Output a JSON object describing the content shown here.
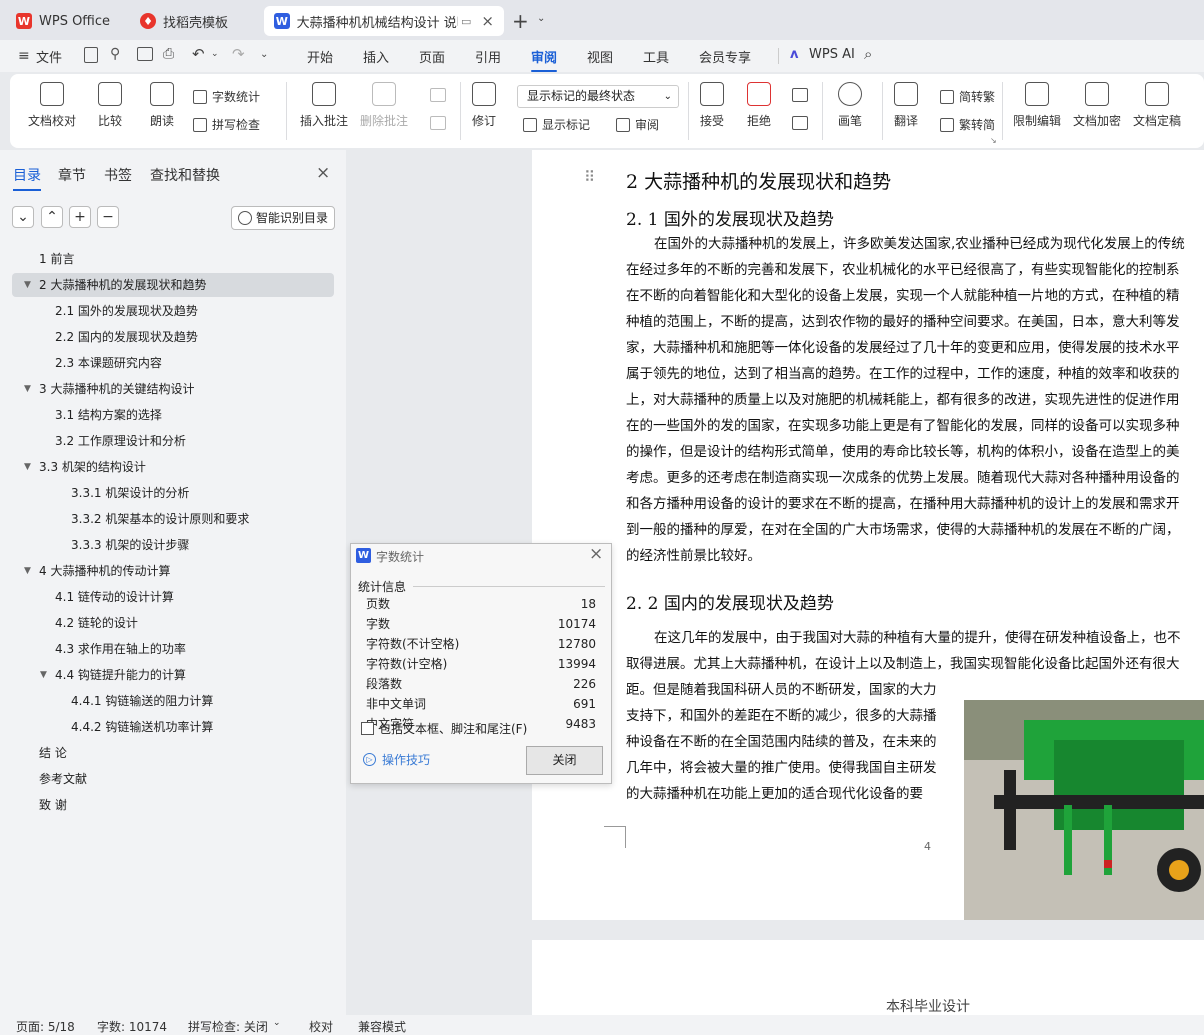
{
  "tabs": [
    {
      "label": "WPS Office"
    },
    {
      "label": "找稻壳模板"
    },
    {
      "label": "大蒜播种机机械结构设计 说明"
    }
  ],
  "menu": {
    "file": "文件",
    "items": [
      "开始",
      "插入",
      "页面",
      "引用",
      "审阅",
      "视图",
      "工具",
      "会员专享"
    ],
    "ai": "WPS AI"
  },
  "ribbon": {
    "proof": "文档校对",
    "compare": "比较",
    "read": "朗读",
    "wordcount": "字数统计",
    "spell": "拼写检查",
    "insert_comment": "插入批注",
    "delete_comment": "删除批注",
    "revise": "修订",
    "markup_select": "显示标记的最终状态",
    "show_markup": "显示标记",
    "review": "审阅",
    "accept": "接受",
    "reject": "拒绝",
    "pen": "画笔",
    "translate": "翻译",
    "to_trad": "简转繁",
    "to_simp": "繁转简",
    "restrict": "限制编辑",
    "encrypt": "文档加密",
    "finalize": "文档定稿"
  },
  "nav": {
    "tabs": [
      "目录",
      "章节",
      "书签",
      "查找和替换"
    ],
    "smart": "智能识别目录",
    "toc": [
      "1  前言",
      "2  大蒜播种机的发展现状和趋势",
      "2.1  国外的发展现状及趋势",
      "2.2  国内的发展现状及趋势",
      "2.3  本课题研究内容",
      "3  大蒜播种机的关键结构设计",
      "3.1 结构方案的选择",
      "3.2  工作原理设计和分析",
      "3.3 机架的结构设计",
      "3.3.1 机架设计的分析",
      "3.3.2 机架基本的设计原则和要求",
      "3.3.3 机架的设计步骤",
      "4  大蒜播种机的传动计算",
      "4.1 链传动的设计计算",
      "4.2 链轮的设计",
      "4.3 求作用在轴上的功率",
      "4.4 钩链提升能力的计算",
      "4.4.1 钩链输送的阻力计算",
      "4.4.2 钩链输送机功率计算",
      "结  论",
      "参考文献",
      "致  谢"
    ]
  },
  "doc": {
    "h1": "2  大蒜播种机的发展现状和趋势",
    "h21": "2. 1  国外的发展现状及趋势",
    "p1": [
      "在国外的大蒜播种机的发展上，许多欧美发达国家,农业播种已经成为现代化发展上的传统",
      "在经过多年的不断的完善和发展下，农业机械化的水平已经很高了，有些实现智能化的控制系",
      "在不断的向着智能化和大型化的设备上发展，实现一个人就能种植一片地的方式，在种植的精",
      "种植的范围上，不断的提高，达到农作物的最好的播种空间要求。在美国，日本，意大利等发",
      "家，大蒜播种机和施肥等一体化设备的发展经过了几十年的变更和应用，使得发展的技术水平",
      "属于领先的地位，达到了相当高的趋势。在工作的过程中，工作的速度，种植的效率和收获的",
      "上，对大蒜播种的质量上以及对施肥的机械耗能上，都有很多的改进，实现先进性的促进作用",
      "在的一些国外的发的国家，在实现多功能上更是有了智能化的发展，同样的设备可以实现多种",
      "的操作，但是设计的结构形式简单，使用的寿命比较长等，机构的体积小，设备在造型上的美",
      "考虑。更多的还考虑在制造商实现一次成条的优势上发展。随着现代大蒜对各种播种用设备的",
      "和各方播种用设备的设计的要求在不断的提高，在播种用大蒜播种机的设计上的发展和需求开",
      "到一般的播种的厚爱，在对在全国的广大市场需求，使得的大蒜播种机的发展在不断的广阔，",
      "的经济性前景比较好。"
    ],
    "h22": "2. 2  国内的发展现状及趋势",
    "p2": [
      "在这几年的发展中，由于我国对大蒜的种植有大量的提升，使得在研发种植设备上，也不",
      "取得进展。尤其上大蒜播种机，在设计上以及制造上，我国实现智能化设备比起国外还有很大",
      "距。但是随着我国科研人员的不断研发，国家的大力",
      "支持下，和国外的差距在不断的减少，很多的大蒜播",
      "种设备在不断的在全国范围内陆续的普及，在未来的",
      "几年中，将会被大量的推广使用。使得我国自主研发",
      "的大蒜播种机在功能上更加的适合现代化设备的要"
    ],
    "page_num": "4",
    "header2": "本科毕业设计"
  },
  "dialog": {
    "title": "字数统计",
    "section": "统计信息",
    "rows": [
      [
        "页数",
        "18"
      ],
      [
        "字数",
        "10174"
      ],
      [
        "字符数(不计空格)",
        "12780"
      ],
      [
        "字符数(计空格)",
        "13994"
      ],
      [
        "段落数",
        "226"
      ],
      [
        "非中文单词",
        "691"
      ],
      [
        "中文字符",
        "9483"
      ]
    ],
    "checkbox": "包括文本框、脚注和尾注(F)",
    "tips": "操作技巧",
    "close": "关闭"
  },
  "status": {
    "page": "页面: 5/18",
    "words": "字数: 10174",
    "spell": "拼写检查: 关闭",
    "proof": "校对",
    "compat": "兼容模式"
  },
  "colors": {
    "accent": "#1a5fd6",
    "wps_red": "#e8352c",
    "doc_blue": "#2f5ee0",
    "machine_green": "#1fa33a"
  }
}
